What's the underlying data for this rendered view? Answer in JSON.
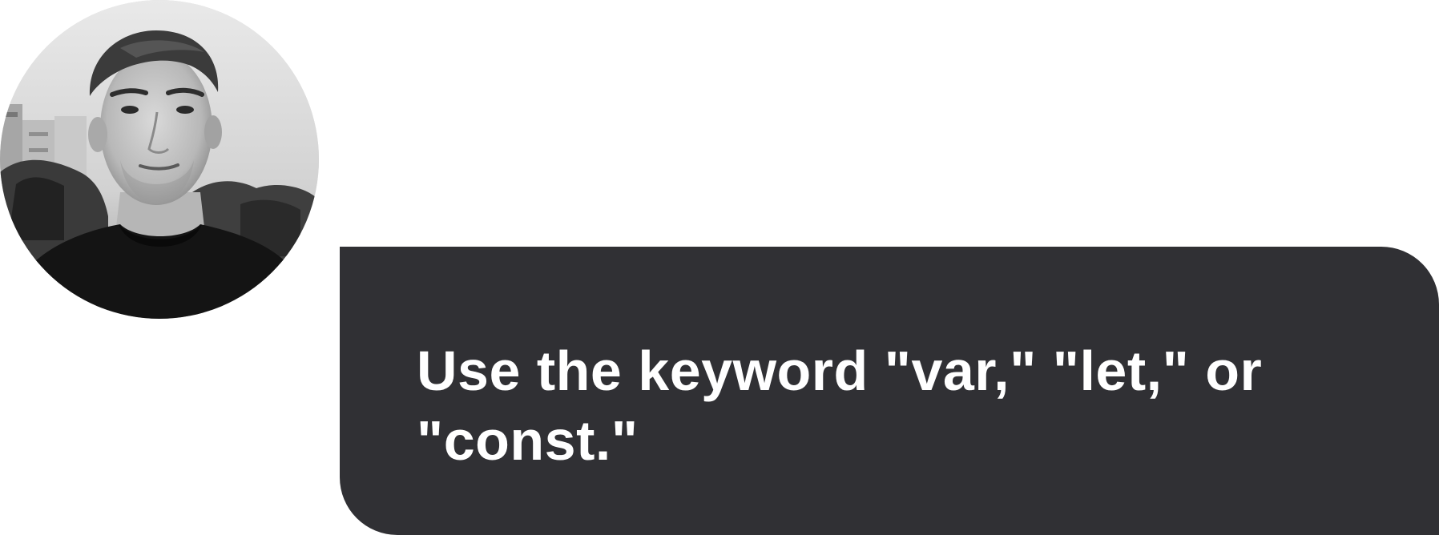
{
  "chat": {
    "avatar": {
      "icon": "person-photo",
      "style": "black-and-white"
    },
    "message": {
      "text": "Use the keyword \"var,\" \"let,\" or \"const.\"",
      "bubble_color": "#303034",
      "text_color": "#ffffff"
    }
  }
}
